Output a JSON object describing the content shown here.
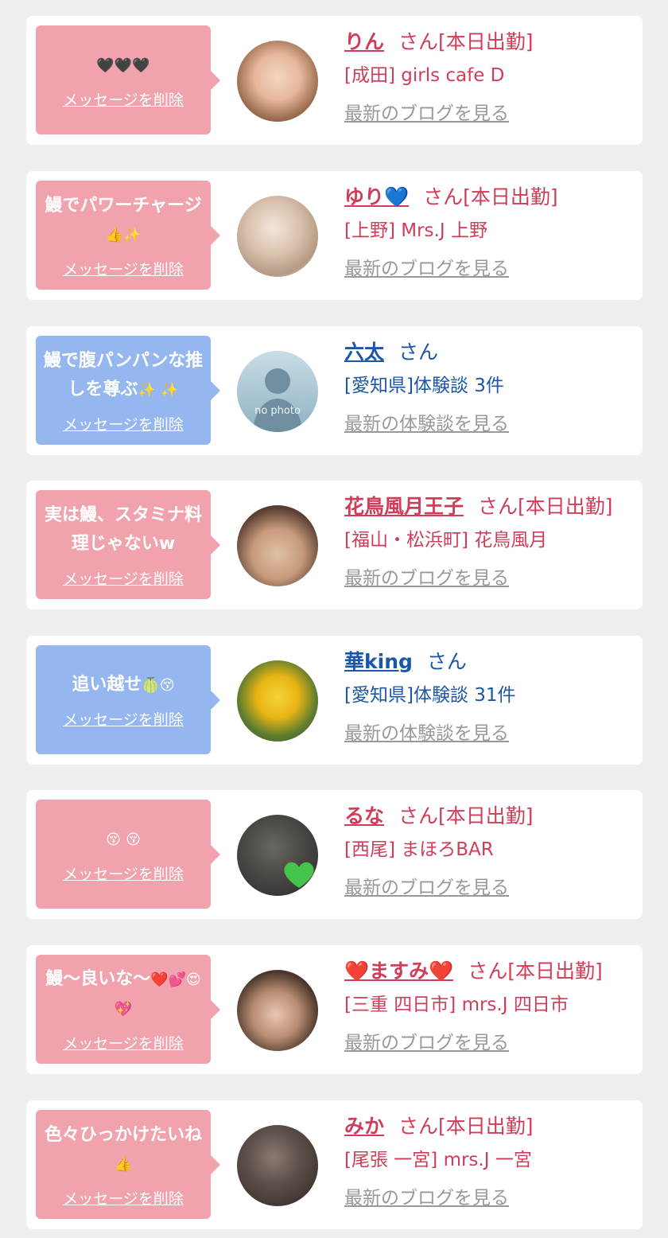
{
  "cards": [
    {
      "message": "",
      "message_emoji": "🖤🖤🖤",
      "delete_label": "メッセージを削除",
      "name": "りん",
      "san": "さん[本日出勤]",
      "shop": "[成田] girls cafe D",
      "link": "最新のブログを見る"
    },
    {
      "message": "鰻でパワーチャージ",
      "message_emoji": "👍✨",
      "delete_label": "メッセージを削除",
      "name": "ゆり💙",
      "san": "さん[本日出勤]",
      "shop": "[上野] Mrs.J 上野",
      "link": "最新のブログを見る"
    },
    {
      "message": "鰻で腹パンパンな推しを尊ぶ",
      "message_emoji": "✨ ✨",
      "delete_label": "メッセージを削除",
      "name": "六太",
      "san": "さん",
      "shop": "[愛知県]体験談 3件",
      "link": "最新の体験談を見る",
      "avatar_text": "no photo"
    },
    {
      "message": "実は鰻、スタミナ料理じゃないw",
      "message_emoji": "",
      "delete_label": "メッセージを削除",
      "name": "花鳥風月王子",
      "san": "さん[本日出勤]",
      "shop": "[福山・松浜町] 花鳥風月",
      "link": "最新のブログを見る"
    },
    {
      "message": "追い越せ",
      "message_emoji": "🍈😚",
      "delete_label": "メッセージを削除",
      "name": "華king",
      "san": "さん",
      "shop": "[愛知県]体験談 31件",
      "link": "最新の体験談を見る"
    },
    {
      "message": "",
      "message_emoji": "😚 😚",
      "delete_label": "メッセージを削除",
      "name": "るな",
      "san": "さん[本日出勤]",
      "shop": "[西尾] まほろBAR",
      "link": "最新のブログを見る"
    },
    {
      "message": "鰻〜良いな〜",
      "message_emoji": "❤️💕😍💖",
      "delete_label": "メッセージを削除",
      "name": "❤️ますみ❤️",
      "san": "さん[本日出勤]",
      "shop": "[三重 四日市] mrs.J 四日市",
      "link": "最新のブログを見る"
    },
    {
      "message": "色々ひっかけたいね",
      "message_emoji": "👍",
      "delete_label": "メッセージを削除",
      "name": "みか",
      "san": "さん[本日出勤]",
      "shop": "[尾張 一宮] mrs.J 一宮",
      "link": "最新のブログを見る"
    }
  ]
}
